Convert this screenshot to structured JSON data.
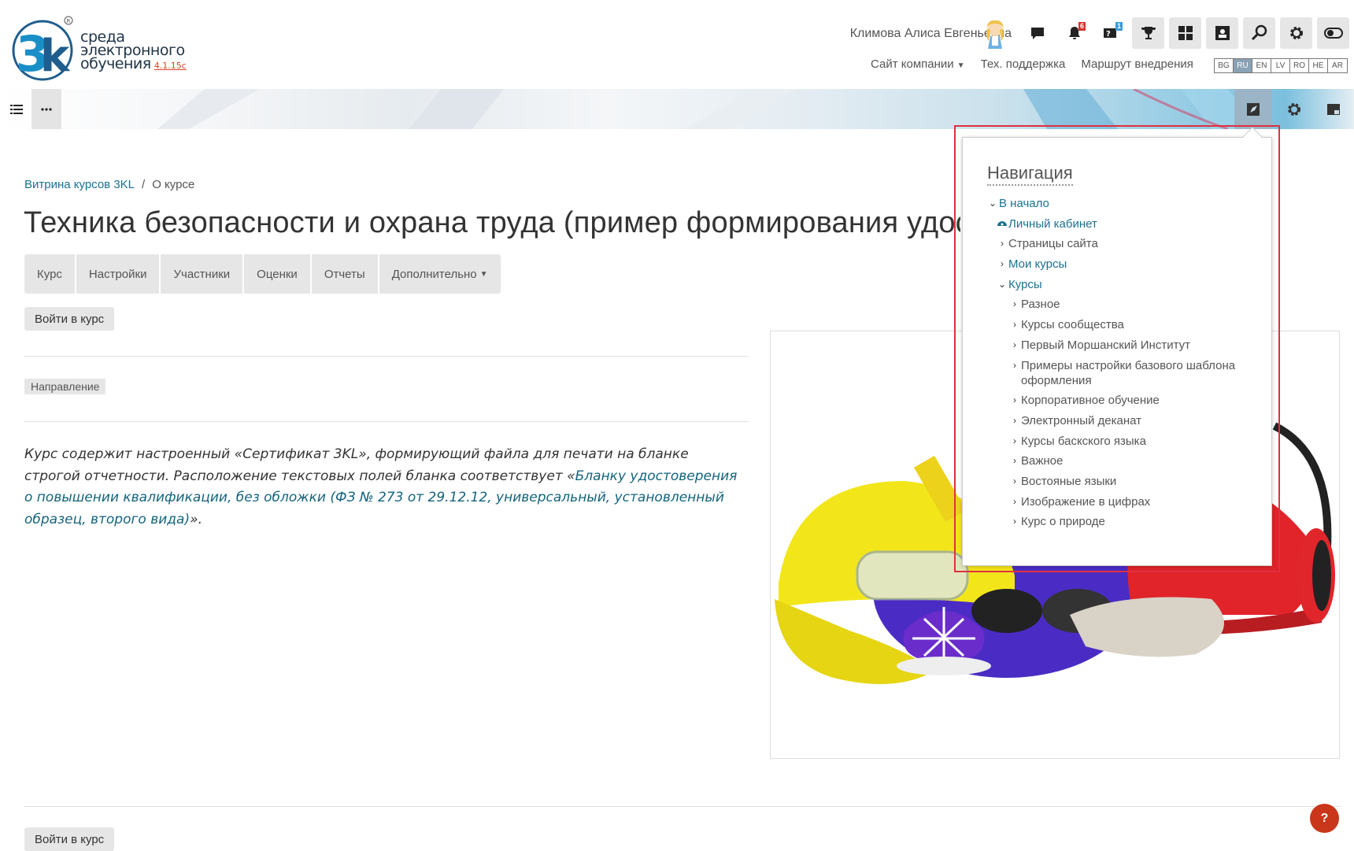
{
  "logo": {
    "line1": "среда",
    "line2": "электронного",
    "line3": "обучения",
    "version": "4.1.15c"
  },
  "header": {
    "user_name": "Климова Алиса Евгеньевна",
    "notifications_count": "6",
    "questions_count": "1",
    "links": {
      "company_site": "Сайт компании",
      "support": "Тех. поддержка",
      "route": "Маршрут внедрения"
    },
    "languages": [
      "BG",
      "RU",
      "EN",
      "LV",
      "RO",
      "HE",
      "AR"
    ],
    "active_language": "RU"
  },
  "breadcrumb": {
    "root": "Витрина курсов 3KL",
    "separator": "/",
    "current": "О курсе"
  },
  "page": {
    "title": "Техника безопасности и охрана труда (пример формирования удостоверения)",
    "tabs": [
      "Курс",
      "Настройки",
      "Участники",
      "Оценки",
      "Отчеты",
      "Дополнительно"
    ],
    "enter_button": "Войти в курс",
    "tag": "Направление",
    "description_plain": "Курс содержит настроенный «Сертификат 3KL», формирующий файла для печати на бланке строгой отчетности. Расположение текстовых полей бланка соответствует «",
    "description_link": "Бланку удостоверения о повышении квалификации, без обложки (ФЗ № 273 от 29.12.12, универсальный, установленный образец, второго вида)",
    "description_end": "».",
    "help_label": "?"
  },
  "navigation": {
    "title": "Навигация",
    "home": "В начало",
    "dashboard": "Личный кабинет",
    "site_pages": "Страницы сайта",
    "my_courses": "Мои курсы",
    "courses": "Курсы",
    "categories": [
      "Разное",
      "Курсы сообщества",
      "Первый Моршанский Институт",
      "Примеры настройки базового шаблона оформления",
      "Корпоративное обучение",
      "Электронный деканат",
      "Курсы баскского языка",
      "Важное",
      "Востояные языки",
      "Изображение в цифрах",
      "Курс о природе"
    ]
  },
  "colors": {
    "link": "#1a7290",
    "highlight_border": "#e0303e",
    "help_button": "#c9361a",
    "logo_blue": "#1a8fc7"
  }
}
